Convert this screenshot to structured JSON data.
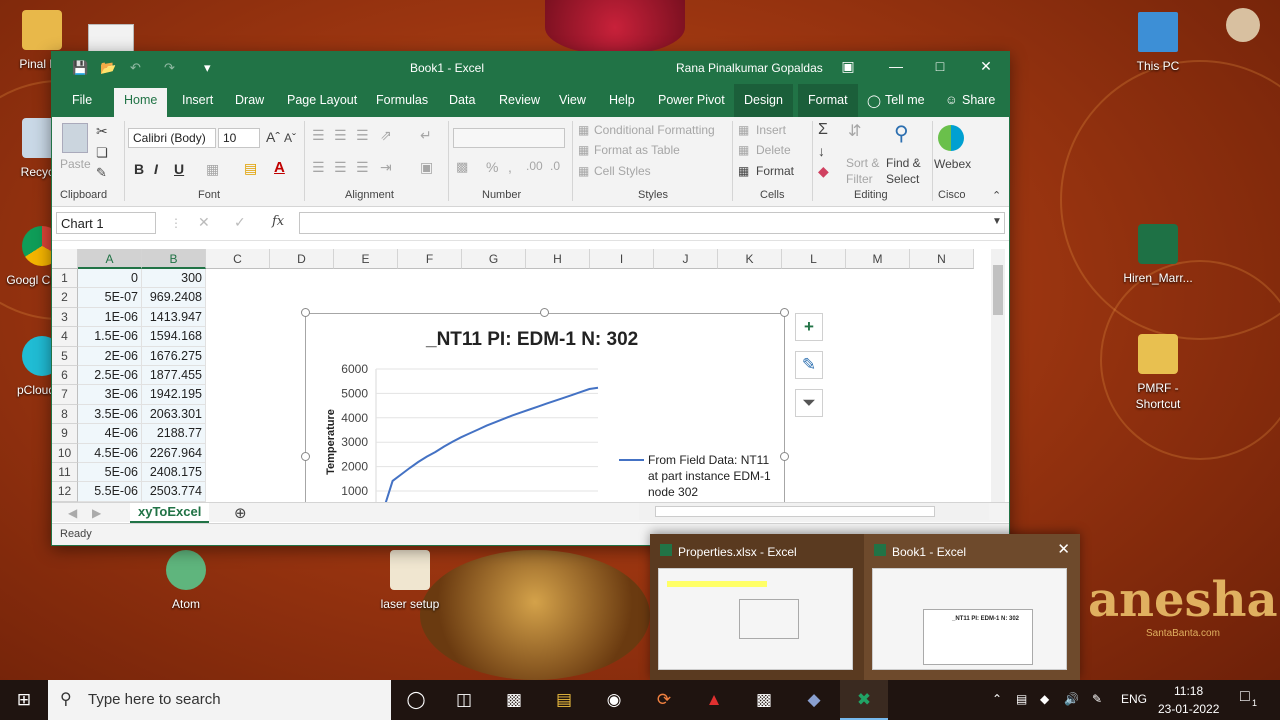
{
  "desktop": {
    "icons": [
      {
        "label": "Pinal Ra"
      },
      {
        "label": "Recycle"
      },
      {
        "label": "Googl Chrom"
      },
      {
        "label": "pCloud D"
      },
      {
        "label": "This PC"
      },
      {
        "label": "Hiren_Marr..."
      },
      {
        "label": "PMRF - Shortcut"
      },
      {
        "label": "Atom"
      },
      {
        "label": "laser setup"
      }
    ],
    "wallpaper_text": "anesha",
    "wallpaper_subtext": "SantaBanta.com"
  },
  "excel": {
    "title": "Book1  -  Excel",
    "user": "Rana Pinalkumar Gopaldas",
    "tabs": [
      "File",
      "Home",
      "Insert",
      "Draw",
      "Page Layout",
      "Formulas",
      "Data",
      "Review",
      "View",
      "Help",
      "Power Pivot",
      "Design",
      "Format"
    ],
    "tell_me": "Tell me",
    "share": "Share",
    "ribbon": {
      "paste": "Paste",
      "font_name": "Calibri (Body)",
      "font_size": "10",
      "conditional_formatting": "Conditional Formatting",
      "format_as_table": "Format as Table",
      "cell_styles": "Cell Styles",
      "insert": "Insert",
      "delete": "Delete",
      "format": "Format",
      "sort_filter": "Sort & Filter",
      "find_select": "Find & Select",
      "webex": "Webex",
      "groups": {
        "clipboard": "Clipboard",
        "font": "Font",
        "alignment": "Alignment",
        "number": "Number",
        "styles": "Styles",
        "cells": "Cells",
        "editing": "Editing",
        "cisco": "Cisco"
      }
    },
    "name_box": "Chart 1",
    "fx": "fx",
    "columns": [
      "A",
      "B",
      "C",
      "D",
      "E",
      "F",
      "G",
      "H",
      "I",
      "J",
      "K",
      "L",
      "M",
      "N"
    ],
    "rows": [
      {
        "n": "1",
        "a": "0",
        "b": "300"
      },
      {
        "n": "2",
        "a": "5E-07",
        "b": "969.2408"
      },
      {
        "n": "3",
        "a": "1E-06",
        "b": "1413.947"
      },
      {
        "n": "4",
        "a": "1.5E-06",
        "b": "1594.168"
      },
      {
        "n": "5",
        "a": "2E-06",
        "b": "1676.275"
      },
      {
        "n": "6",
        "a": "2.5E-06",
        "b": "1877.455"
      },
      {
        "n": "7",
        "a": "3E-06",
        "b": "1942.195"
      },
      {
        "n": "8",
        "a": "3.5E-06",
        "b": "2063.301"
      },
      {
        "n": "9",
        "a": "4E-06",
        "b": "2188.77"
      },
      {
        "n": "10",
        "a": "4.5E-06",
        "b": "2267.964"
      },
      {
        "n": "11",
        "a": "5E-06",
        "b": "2408.175"
      },
      {
        "n": "12",
        "a": "5.5E-06",
        "b": "2503.774"
      }
    ],
    "sheet_tab": "xyToExcel",
    "status": "Ready",
    "accent": "#217346"
  },
  "chart_data": {
    "type": "line",
    "title": "_NT11 PI: EDM-1 N: 302",
    "ylabel": "Temperature",
    "xlabel": "",
    "ylim": [
      0,
      6000
    ],
    "yticks": [
      "6000",
      "5000",
      "4000",
      "3000",
      "2000",
      "1000"
    ],
    "series": [
      {
        "name": "From Field Data: NT11 at part instance EDM-1 node 302",
        "color": "#4472c4",
        "values": [
          300,
          1414,
          1676,
          1942,
          2189,
          2408,
          2600,
          2820,
          3020,
          3200,
          3360,
          3520,
          3680,
          3820,
          3960,
          4100,
          4220,
          4340,
          4460,
          4580,
          4700,
          4820,
          4940,
          5060,
          5180,
          5230
        ]
      }
    ],
    "legend_position": "right"
  },
  "taskbar_preview": {
    "items": [
      {
        "title": "Properties.xlsx - Excel"
      },
      {
        "title": "Book1 - Excel"
      }
    ],
    "thumb_chart_title": "_NT11 PI: EDM-1 N: 302"
  },
  "taskbar": {
    "search_placeholder": "Type here to search",
    "language": "ENG",
    "time": "11:18",
    "date": "23-01-2022",
    "notification_count": "1"
  }
}
